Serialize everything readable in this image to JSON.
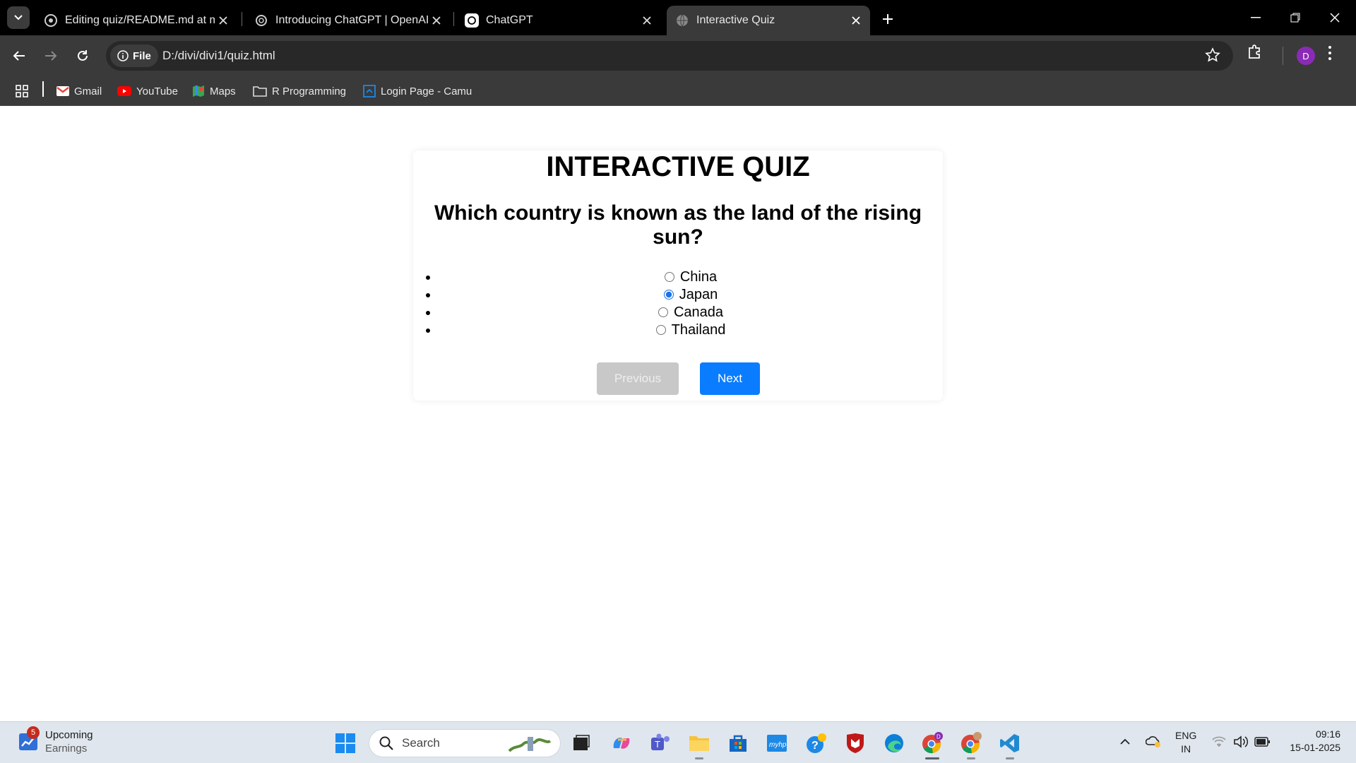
{
  "browser": {
    "tabs": [
      {
        "title": "Editing quiz/README.md at ma",
        "icon": "github-icon"
      },
      {
        "title": "Introducing ChatGPT | OpenAI",
        "icon": "openai-icon"
      },
      {
        "title": "ChatGPT",
        "icon": "openai-icon"
      },
      {
        "title": "Interactive Quiz",
        "icon": "globe-icon",
        "active": true
      }
    ],
    "address": {
      "chip_label": "File",
      "url": "D:/divi/divi1/quiz.html"
    },
    "profile_initial": "D",
    "bookmarks": [
      {
        "label": "Gmail",
        "icon": "gmail-icon"
      },
      {
        "label": "YouTube",
        "icon": "youtube-icon"
      },
      {
        "label": "Maps",
        "icon": "maps-icon"
      },
      {
        "label": "R Programming",
        "icon": "folder-icon"
      },
      {
        "label": "Login Page - Camu",
        "icon": "camu-icon"
      }
    ]
  },
  "quiz": {
    "title": "INTERACTIVE QUIZ",
    "question": "Which country is known as the land of the rising sun?",
    "options": [
      {
        "label": "China",
        "checked": false
      },
      {
        "label": "Japan",
        "checked": true
      },
      {
        "label": "Canada",
        "checked": false
      },
      {
        "label": "Thailand",
        "checked": false
      }
    ],
    "prev_label": "Previous",
    "next_label": "Next"
  },
  "taskbar": {
    "widget_badge": "5",
    "widget_title": "Upcoming",
    "widget_sub": "Earnings",
    "search_label": "Search",
    "lang_top": "ENG",
    "lang_bottom": "IN",
    "time": "09:16",
    "date": "15-01-2025"
  },
  "colors": {
    "accent": "#0a7cff",
    "disabled": "#c8c8c8"
  }
}
